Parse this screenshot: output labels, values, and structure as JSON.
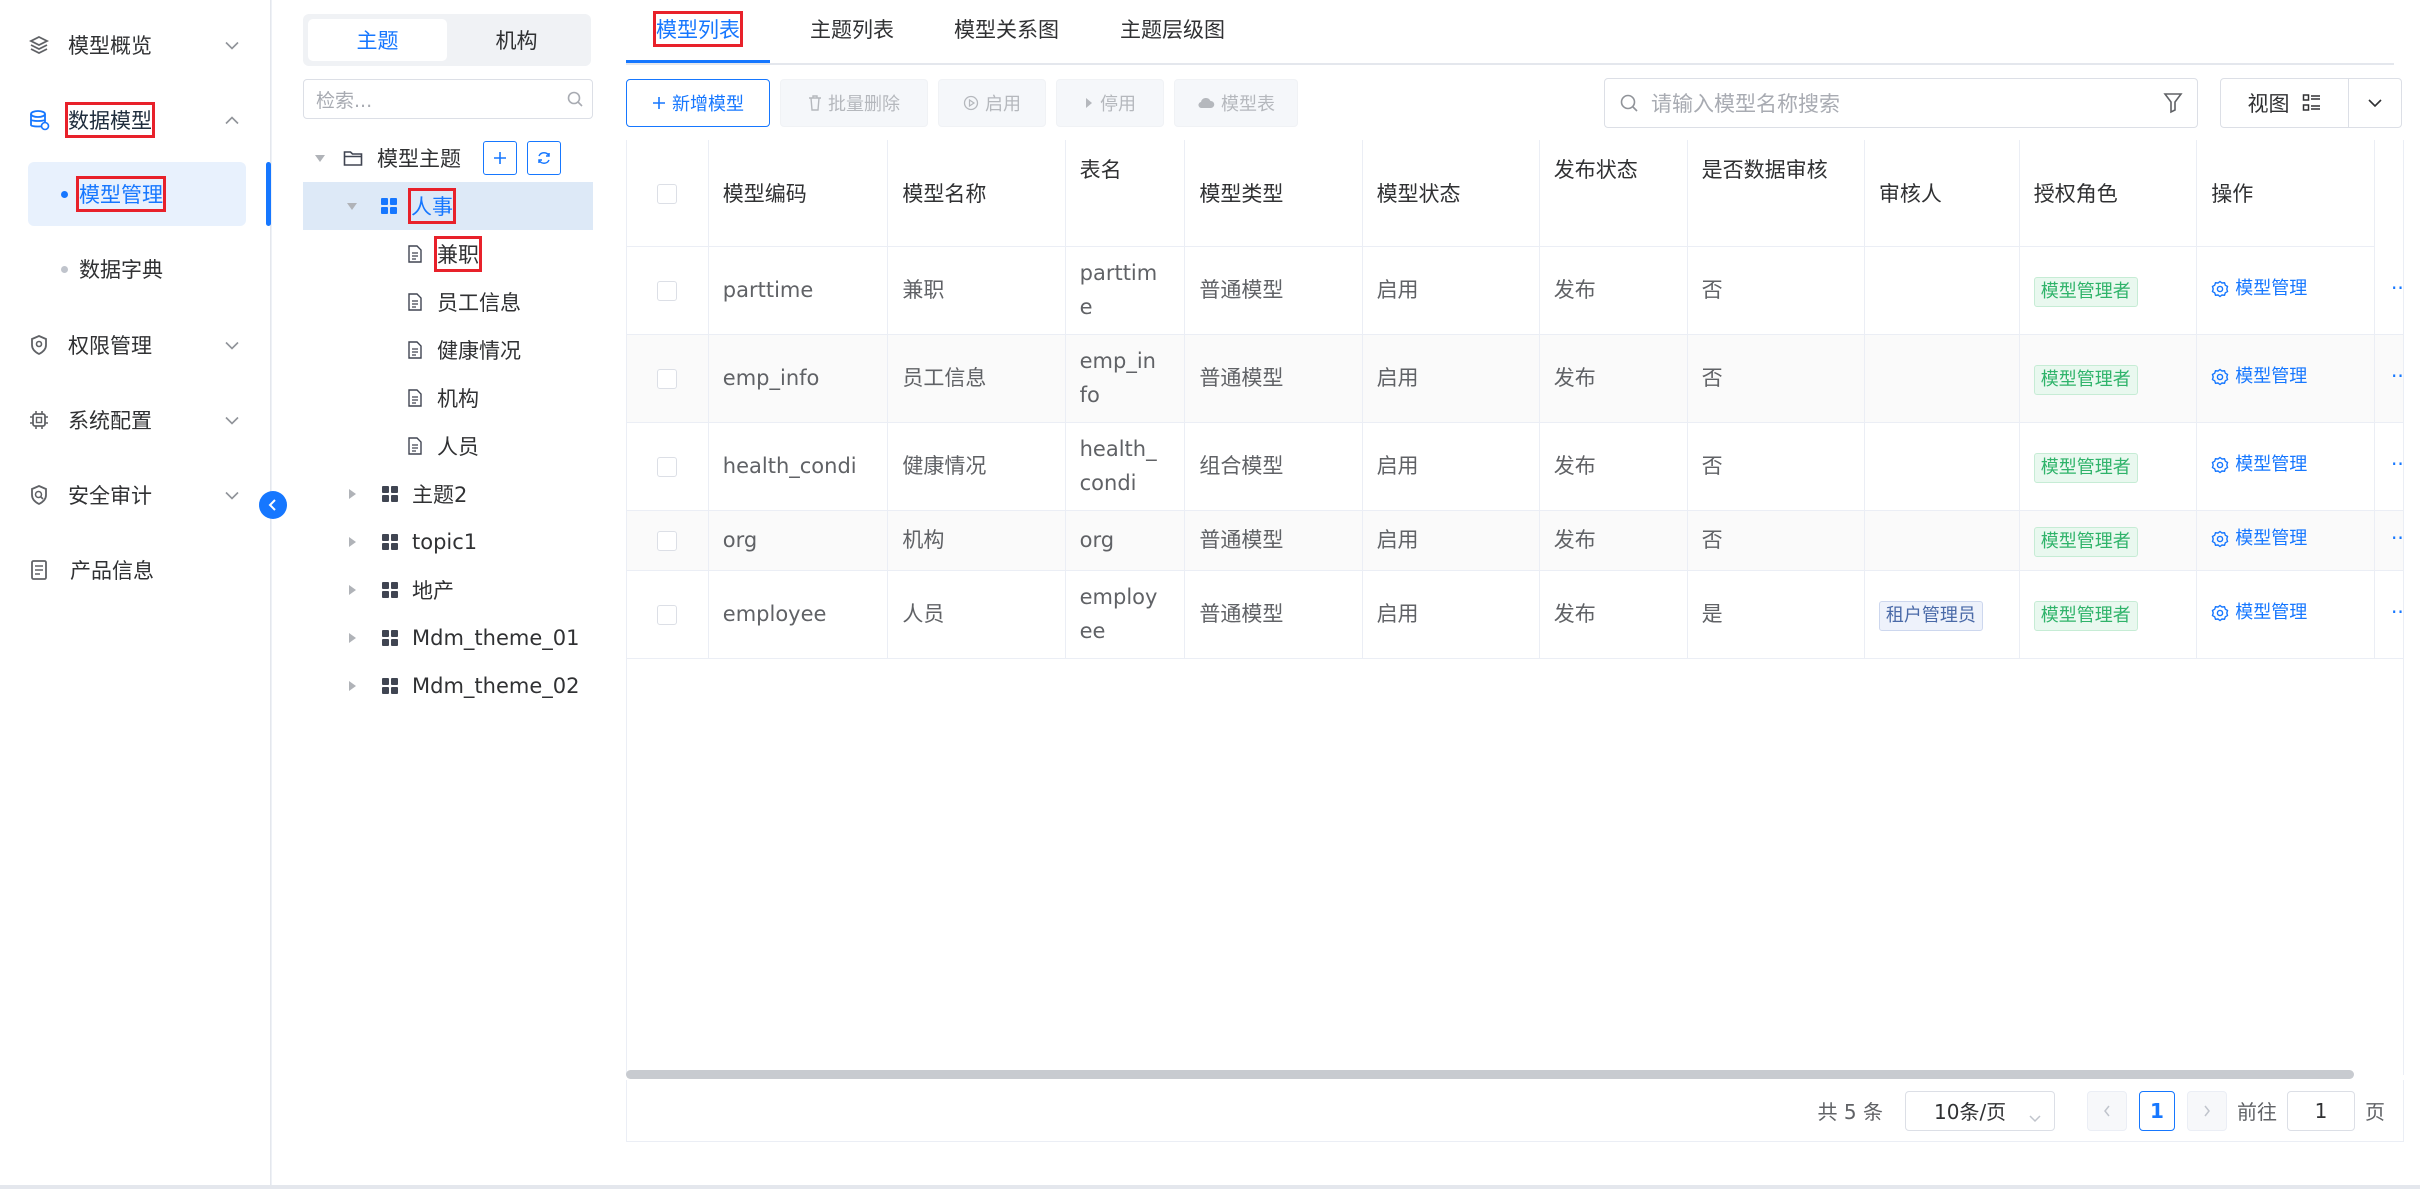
{
  "sidebar": {
    "menu": [
      {
        "label": "模型概览",
        "icon": "layers-icon"
      },
      {
        "label": "数据模型",
        "icon": "database-icon"
      },
      {
        "label": "权限管理",
        "icon": "shield-icon"
      },
      {
        "label": "系统配置",
        "icon": "chip-icon"
      },
      {
        "label": "安全审计",
        "icon": "audit-shield-icon"
      },
      {
        "label": "产品信息",
        "icon": "document-icon"
      }
    ],
    "submenu": [
      {
        "label": "模型管理"
      },
      {
        "label": "数据字典"
      }
    ]
  },
  "tree_panel": {
    "segments": [
      "主题",
      "机构"
    ],
    "search_placeholder": "检索...",
    "root_label": "模型主题",
    "nodes": [
      {
        "label": "人事"
      },
      {
        "label": "兼职"
      },
      {
        "label": "员工信息"
      },
      {
        "label": "健康情况"
      },
      {
        "label": "机构"
      },
      {
        "label": "人员"
      },
      {
        "label": "主题2"
      },
      {
        "label": "topic1"
      },
      {
        "label": "地产"
      },
      {
        "label": "Mdm_theme_01"
      },
      {
        "label": "Mdm_theme_02"
      }
    ]
  },
  "main": {
    "tabs": [
      "模型列表",
      "主题列表",
      "模型关系图",
      "主题层级图"
    ],
    "toolbar": {
      "add": "新增模型",
      "batch_delete": "批量删除",
      "enable": "启用",
      "disable": "停用",
      "model_table": "模型表",
      "search_placeholder": "请输入模型名称搜索",
      "view": "视图"
    },
    "table": {
      "headers": [
        "模型编码",
        "模型名称",
        "表名",
        "模型类型",
        "模型状态",
        "发布状态",
        "是否数据审核",
        "审核人",
        "授权角色",
        "操作"
      ],
      "rows": [
        {
          "code": "parttime",
          "name": "兼职",
          "table_l1": "parttim",
          "table_l2": "e",
          "type": "普通模型",
          "status": "启用",
          "publish": "发布",
          "audit": "否",
          "reviewer": "",
          "role": "模型管理者",
          "op": "模型管理"
        },
        {
          "code": "emp_info",
          "name": "员工信息",
          "table_l1": "emp_in",
          "table_l2": "fo",
          "type": "普通模型",
          "status": "启用",
          "publish": "发布",
          "audit": "否",
          "reviewer": "",
          "role": "模型管理者",
          "op": "模型管理"
        },
        {
          "code": "health_condi",
          "name": "健康情况",
          "table_l1": "health_",
          "table_l2": "condi",
          "type": "组合模型",
          "status": "启用",
          "publish": "发布",
          "audit": "否",
          "reviewer": "",
          "role": "模型管理者",
          "op": "模型管理"
        },
        {
          "code": "org",
          "name": "机构",
          "table_l1": "org",
          "table_l2": "",
          "type": "普通模型",
          "status": "启用",
          "publish": "发布",
          "audit": "否",
          "reviewer": "",
          "role": "模型管理者",
          "op": "模型管理"
        },
        {
          "code": "employee",
          "name": "人员",
          "table_l1": "employ",
          "table_l2": "ee",
          "type": "普通模型",
          "status": "启用",
          "publish": "发布",
          "audit": "是",
          "reviewer": "租户管理员",
          "role": "模型管理者",
          "op": "模型管理"
        }
      ]
    },
    "pagination": {
      "total": "共 5 条",
      "page_size": "10条/页",
      "current": "1",
      "goto_label": "前往",
      "goto_value": "1",
      "page_suffix": "页"
    }
  },
  "colors": {
    "accent": "#1677ff",
    "highlight": "#e8212a",
    "tag_green": "#2fb36a"
  }
}
